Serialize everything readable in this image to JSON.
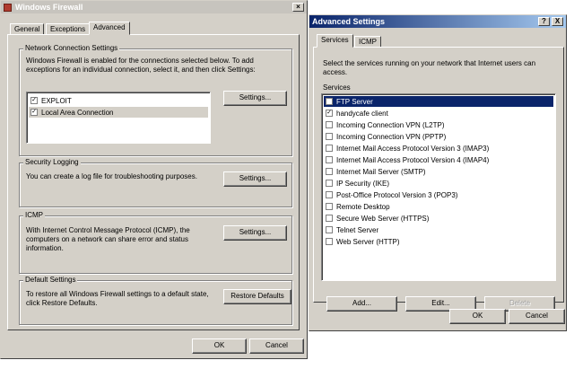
{
  "firewall": {
    "title": "Windows Firewall",
    "tabs": [
      "General",
      "Exceptions",
      "Advanced"
    ],
    "network": {
      "label": "Network Connection Settings",
      "desc": "Windows Firewall is enabled for the connections selected below. To add exceptions for an individual connection, select it, and then click Settings:",
      "connections": [
        {
          "label": "EXPLOIT",
          "checked": true
        },
        {
          "label": "Local Area Connection",
          "checked": true
        }
      ],
      "settings_label": "Settings..."
    },
    "logging": {
      "label": "Security Logging",
      "desc": "You can create a log file for troubleshooting purposes.",
      "settings_label": "Settings..."
    },
    "icmp": {
      "label": "ICMP",
      "desc": "With Internet Control Message Protocol (ICMP), the computers on a network can share error and status information.",
      "settings_label": "Settings..."
    },
    "defaults": {
      "label": "Default Settings",
      "desc": "To restore all Windows Firewall settings to a default state, click Restore Defaults.",
      "restore_label": "Restore Defaults"
    },
    "ok_label": "OK",
    "cancel_label": "Cancel"
  },
  "advanced": {
    "title": "Advanced Settings",
    "help_glyph": "?",
    "close_glyph": "X",
    "tabs": [
      "Services",
      "ICMP"
    ],
    "instructions": "Select the services running on your network that Internet users can access.",
    "services_label": "Services",
    "services": [
      {
        "label": "FTP Server",
        "checked": false
      },
      {
        "label": "handycafe client",
        "checked": true
      },
      {
        "label": "Incoming Connection VPN (L2TP)",
        "checked": false
      },
      {
        "label": "Incoming Connection VPN (PPTP)",
        "checked": false
      },
      {
        "label": "Internet Mail Access Protocol Version 3 (IMAP3)",
        "checked": false
      },
      {
        "label": "Internet Mail Access Protocol Version 4 (IMAP4)",
        "checked": false
      },
      {
        "label": "Internet Mail Server (SMTP)",
        "checked": false
      },
      {
        "label": "IP Security (IKE)",
        "checked": false
      },
      {
        "label": "Post-Office Protocol Version 3 (POP3)",
        "checked": false
      },
      {
        "label": "Remote Desktop",
        "checked": false
      },
      {
        "label": "Secure Web Server (HTTPS)",
        "checked": false
      },
      {
        "label": "Telnet Server",
        "checked": false
      },
      {
        "label": "Web Server (HTTP)",
        "checked": false
      }
    ],
    "add_label": "Add...",
    "edit_label": "Edit...",
    "delete_label": "Delete",
    "ok_label": "OK",
    "cancel_label": "Cancel"
  }
}
